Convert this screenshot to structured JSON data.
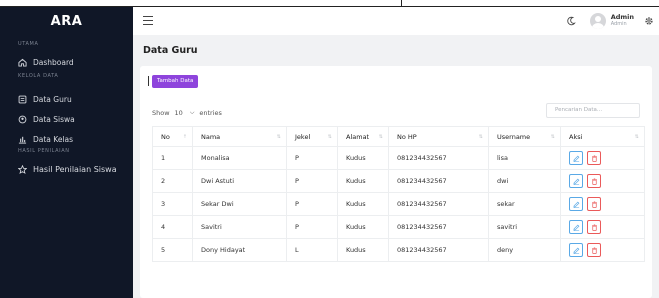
{
  "app": {
    "brand": "ARA"
  },
  "sidebar": {
    "sections": [
      "UTAMA",
      "KELOLA DATA",
      "HASIL PENILAIAN"
    ],
    "items": [
      {
        "label": "Dashboard",
        "icon": "home-icon"
      },
      {
        "label": "Data Guru",
        "icon": "id-card-icon"
      },
      {
        "label": "Data Siswa",
        "icon": "users-icon"
      },
      {
        "label": "Data Kelas",
        "icon": "chart-bar-icon"
      },
      {
        "label": "Hasil Penilaian Siswa",
        "icon": "star-icon"
      }
    ]
  },
  "header": {
    "user_name": "Admin",
    "user_role": "Admin",
    "icons": [
      "hamburger-icon",
      "moon-icon",
      "avatar",
      "gear-icon"
    ]
  },
  "page": {
    "title": "Data Guru"
  },
  "toolbar": {
    "add_label": "Tambah Data"
  },
  "datatable": {
    "show_label": "Show",
    "entries_value": "10",
    "entries_label": "entries",
    "search_placeholder": "Pencarian Data...",
    "columns": [
      "No",
      "Nama",
      "Jekel",
      "Alamat",
      "No HP",
      "Username",
      "Aksi"
    ],
    "rows": [
      {
        "no": "1",
        "nama": "Monalisa",
        "jekel": "P",
        "alamat": "Kudus",
        "hp": "081234432567",
        "username": "lisa"
      },
      {
        "no": "2",
        "nama": "Dwi Astuti",
        "jekel": "P",
        "alamat": "Kudus",
        "hp": "081234432567",
        "username": "dwi"
      },
      {
        "no": "3",
        "nama": "Sekar Dwi",
        "jekel": "P",
        "alamat": "Kudus",
        "hp": "081234432567",
        "username": "sekar"
      },
      {
        "no": "4",
        "nama": "Savitri",
        "jekel": "P",
        "alamat": "Kudus",
        "hp": "081234432567",
        "username": "savitri"
      },
      {
        "no": "5",
        "nama": "Dony Hidayat",
        "jekel": "L",
        "alamat": "Kudus",
        "hp": "081234432567",
        "username": "deny"
      }
    ]
  },
  "colors": {
    "sidebar_bg": "#101727",
    "accent": "#8e44dc",
    "edit": "#5aa9e6",
    "delete": "#ea5a5a"
  }
}
